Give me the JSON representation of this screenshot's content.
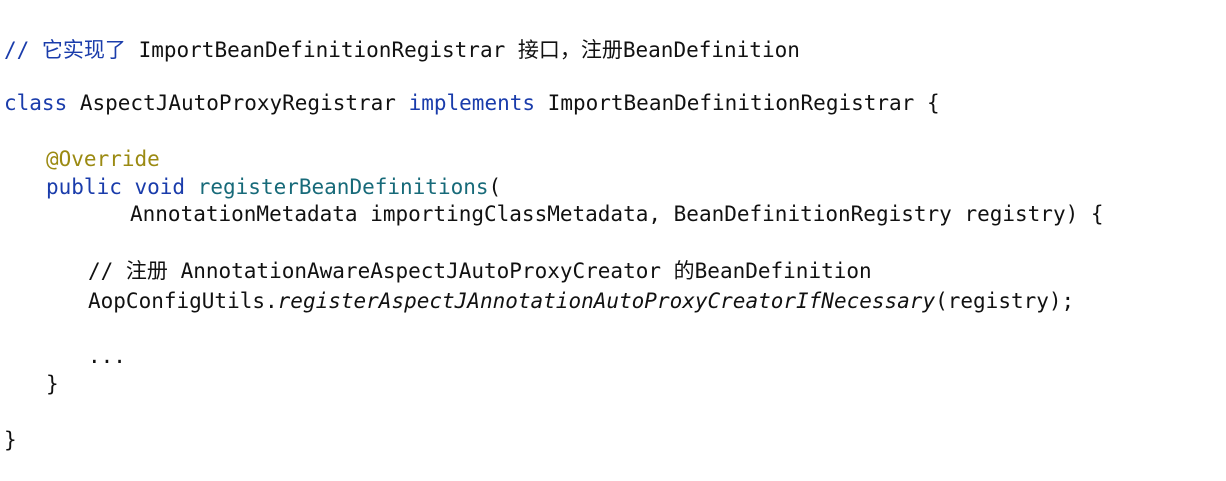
{
  "code": {
    "header_comment_prefix": "// 它实现了",
    "header_comment_rest": " ImportBeanDefinitionRegistrar 接口，注册BeanDefinition",
    "class_keyword": "class",
    "class_name": " AspectJAutoProxyRegistrar ",
    "implements_keyword": "implements",
    "interface_name": " ImportBeanDefinitionRegistrar {",
    "override_annotation": "@Override",
    "method_modifiers": "public void",
    "method_name": "registerBeanDefinitions",
    "method_open_paren": "(",
    "method_params": "AnnotationMetadata importingClassMetadata, BeanDefinitionRegistry registry) {",
    "inner_comment": "// 注册 AnnotationAwareAspectJAutoProxyCreator 的BeanDefinition",
    "call_target": "AopConfigUtils.",
    "call_method": "registerAspectJAnnotationAutoProxyCreatorIfNecessary",
    "call_args": "(registry);",
    "ellipsis": "...",
    "method_close": "}",
    "class_close": "}"
  }
}
